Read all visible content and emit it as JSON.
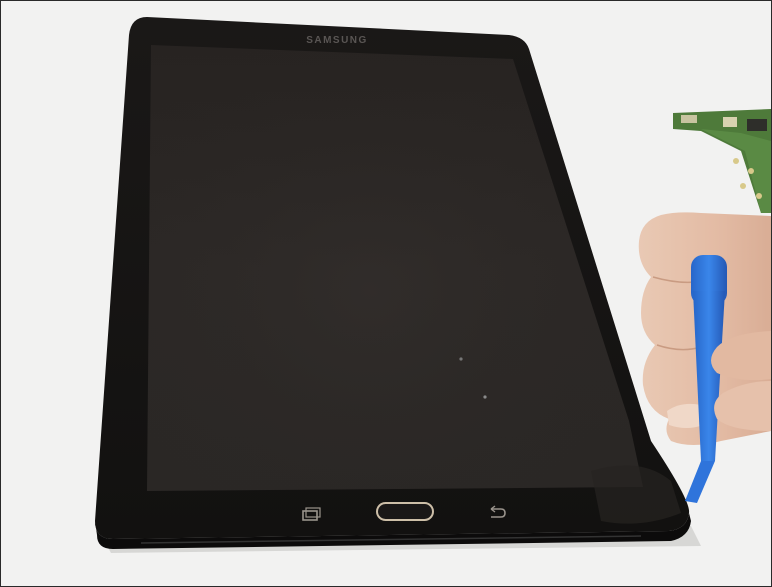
{
  "photo": {
    "subject": "tablet-on-table",
    "device": {
      "brand_text": "SAMSUNG",
      "screen_state": "off",
      "bezel_color": "#1c1a19",
      "screen_color": "#2a2624",
      "home_button_color": "#c9b9a2"
    },
    "tool": {
      "type": "opening-pick",
      "color": "#2f7de0"
    },
    "background_color": "#f3f3f2",
    "circuit_board_color": "#4f7a3c"
  }
}
